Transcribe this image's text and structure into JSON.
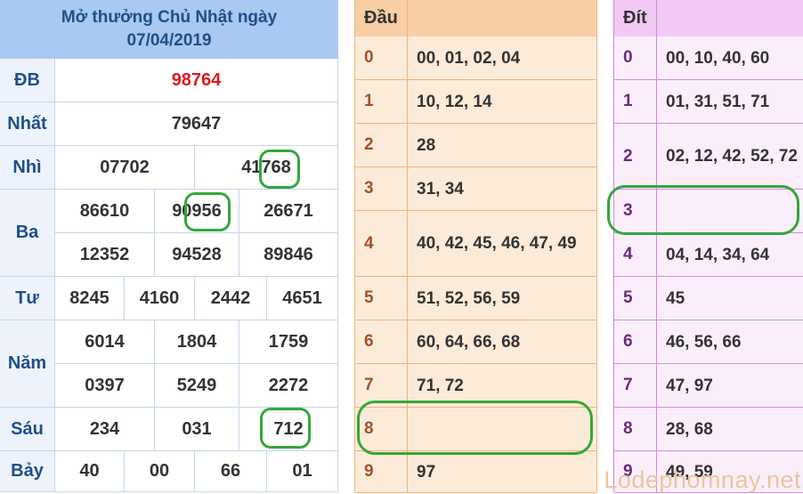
{
  "header": {
    "line1": "Mở thưởng Chủ Nhật ngày",
    "line2": "07/04/2019"
  },
  "prizes": {
    "db": {
      "label": "ĐB",
      "values": [
        "98764"
      ]
    },
    "nhat": {
      "label": "Nhất",
      "values": [
        "79647"
      ]
    },
    "nhi": {
      "label": "Nhì",
      "values": [
        "07702",
        "41768"
      ]
    },
    "ba": {
      "label": "Ba",
      "values": [
        "86610",
        "90956",
        "26671",
        "12352",
        "94528",
        "89846"
      ]
    },
    "tu": {
      "label": "Tư",
      "values": [
        "8245",
        "4160",
        "2442",
        "4651"
      ]
    },
    "nam": {
      "label": "Năm",
      "values": [
        "6014",
        "1804",
        "1759",
        "0397",
        "5249",
        "2272"
      ]
    },
    "sau": {
      "label": "Sáu",
      "values": [
        "234",
        "031",
        "712"
      ]
    },
    "bay": {
      "label": "Bảy",
      "values": [
        "40",
        "00",
        "66",
        "01"
      ]
    }
  },
  "dau": {
    "header": "Đầu",
    "rows": [
      {
        "key": "0",
        "value": "00, 01, 02, 04"
      },
      {
        "key": "1",
        "value": "10, 12, 14"
      },
      {
        "key": "2",
        "value": "28"
      },
      {
        "key": "3",
        "value": "31, 34"
      },
      {
        "key": "4",
        "value": "40, 42, 45, 46, 47, 49"
      },
      {
        "key": "5",
        "value": "51, 52, 56, 59"
      },
      {
        "key": "6",
        "value": "60, 64, 66, 68"
      },
      {
        "key": "7",
        "value": "71, 72"
      },
      {
        "key": "8",
        "value": ""
      },
      {
        "key": "9",
        "value": "97"
      }
    ]
  },
  "dit": {
    "header": "Đít",
    "rows": [
      {
        "key": "0",
        "value": "00, 10, 40, 60"
      },
      {
        "key": "1",
        "value": "01, 31, 51, 71"
      },
      {
        "key": "2",
        "value": "02, 12, 42, 52, 72"
      },
      {
        "key": "3",
        "value": ""
      },
      {
        "key": "4",
        "value": "04, 14, 34, 64"
      },
      {
        "key": "5",
        "value": "45"
      },
      {
        "key": "6",
        "value": "46, 56, 66"
      },
      {
        "key": "7",
        "value": "47, 97"
      },
      {
        "key": "8",
        "value": "28, 68"
      },
      {
        "key": "9",
        "value": "49, 59"
      }
    ]
  },
  "watermark": "Lodephomnay.net",
  "colors": {
    "highlight_ring": "#33a83a",
    "special_prize": "#e0191f"
  }
}
